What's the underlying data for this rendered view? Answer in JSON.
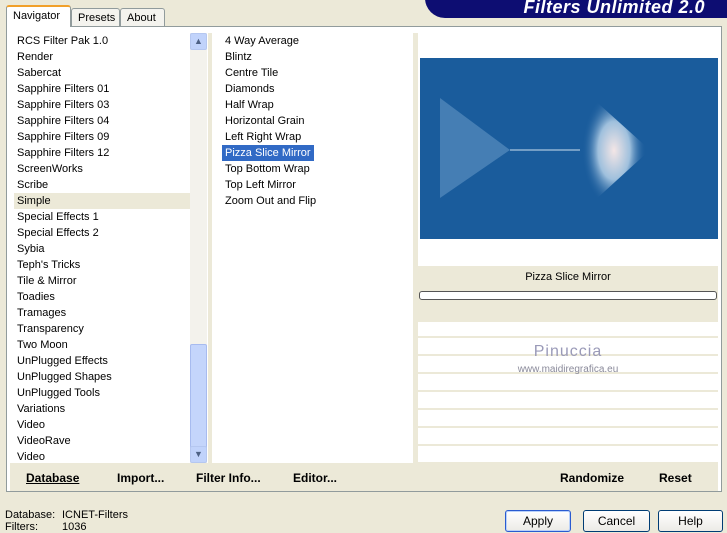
{
  "title": "Filters Unlimited 2.0",
  "tabs": [
    {
      "label": "Navigator"
    },
    {
      "label": "Presets"
    },
    {
      "label": "About"
    }
  ],
  "categories": [
    "RCS Filter Pak 1.0",
    "Render",
    "Sabercat",
    "Sapphire Filters 01",
    "Sapphire Filters 03",
    "Sapphire Filters 04",
    "Sapphire Filters 09",
    "Sapphire Filters 12",
    "ScreenWorks",
    "Scribe",
    "Simple",
    "Special Effects 1",
    "Special Effects 2",
    "Sybia",
    "Teph's Tricks",
    "Tile & Mirror",
    "Toadies",
    "Tramages",
    "Transparency",
    "Two Moon",
    "UnPlugged Effects",
    "UnPlugged Shapes",
    "UnPlugged Tools",
    "Variations",
    "Video",
    "VideoRave",
    "Video"
  ],
  "selected_category": "Simple",
  "filters": [
    "4 Way Average",
    "Blintz",
    "Centre Tile",
    "Diamonds",
    "Half Wrap",
    "Horizontal Grain",
    "Left Right Wrap",
    "Pizza Slice Mirror",
    "Top Bottom Wrap",
    "Top Left Mirror",
    "Zoom Out and Flip"
  ],
  "selected_filter": "Pizza Slice Mirror",
  "preview": {
    "filter_name": "Pizza Slice Mirror",
    "progress": 0,
    "watermark_name": "Pinuccia",
    "watermark_url": "www.maidiregrafica.eu",
    "color": "#1a5c9c"
  },
  "left_buttons": [
    {
      "label": "Database"
    },
    {
      "label": "Import..."
    },
    {
      "label": "Filter Info..."
    },
    {
      "label": "Editor..."
    }
  ],
  "right_buttons": [
    {
      "label": "Randomize"
    },
    {
      "label": "Reset"
    }
  ],
  "status": {
    "database_label": "Database:",
    "database_value": "ICNET-Filters",
    "filters_label": "Filters:",
    "filters_value": "1036"
  },
  "dialog_buttons": [
    {
      "label": "Apply"
    },
    {
      "label": "Cancel"
    },
    {
      "label": "Help"
    }
  ]
}
